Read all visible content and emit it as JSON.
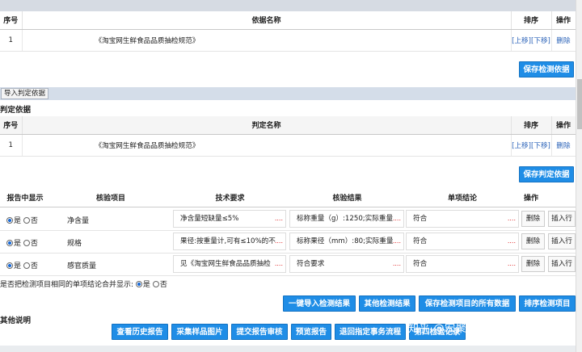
{
  "basis_table": {
    "headers": {
      "seq": "序号",
      "name": "依据名称",
      "sort": "排序",
      "op": "操作"
    },
    "rows": [
      {
        "seq": "1",
        "name": "《淘宝网生鲜食品品质抽检规范》",
        "up": "[上移]",
        "down": "[下移]",
        "delete": "删除"
      }
    ],
    "save_label": "保存检测依据"
  },
  "tab_bar": {
    "import_label": "导入判定依据"
  },
  "judge_section": {
    "title": "判定依据",
    "headers": {
      "seq": "序号",
      "name": "判定名称",
      "sort": "排序",
      "op": "操作"
    },
    "rows": [
      {
        "seq": "1",
        "name": "《淘宝网生鲜食品品质抽检规范》",
        "up": "[上移]",
        "down": "[下移]",
        "delete": "删除"
      }
    ],
    "save_label": "保存判定依据"
  },
  "items_table": {
    "headers": {
      "show": "报告中显示",
      "item": "核验项目",
      "req": "技术要求",
      "result": "核验结果",
      "conclusion": "单项结论",
      "op": "操作"
    },
    "yes_label": "是",
    "no_label": "否",
    "delete_label": "删除",
    "insert_label": "插入行",
    "dots": "....",
    "rows": [
      {
        "item": "净含量",
        "req": "净含量短缺量≤5%",
        "result": "标称重量（g）:1250;实际重量",
        "conclusion": "符合"
      },
      {
        "item": "规格",
        "req": "果径:按重量计,可有≤10%的不",
        "result": "标称果径（mm）:80;实际重量",
        "conclusion": "符合"
      },
      {
        "item": "感官质量",
        "req": "见《淘宝网生鲜食品品质抽检",
        "result": "符合要求",
        "conclusion": "符合"
      }
    ]
  },
  "merge_question": {
    "label": "是否把检测项目相同的单项结论合并显示:",
    "yes": "是",
    "no": "否"
  },
  "action_buttons": {
    "import_results": "一键导入检测结果",
    "other_results": "其他检测结果",
    "save_all": "保存检测项目的所有数据",
    "sort_items": "排序检测项目"
  },
  "other_section": {
    "title": "其他说明"
  },
  "bottom_buttons": {
    "history": "查看历史报告",
    "collect_images": "采集样品图片",
    "submit_review": "提交报告审核",
    "preview": "预览报告",
    "return_flow": "退回指定事务流程",
    "fourth_record": "第四检验记录"
  },
  "watermark": "知乎 @宏聚lims系统",
  "colors": {
    "accent": "#1f8de6",
    "link": "#2a62b8",
    "danger": "#dd1111"
  }
}
